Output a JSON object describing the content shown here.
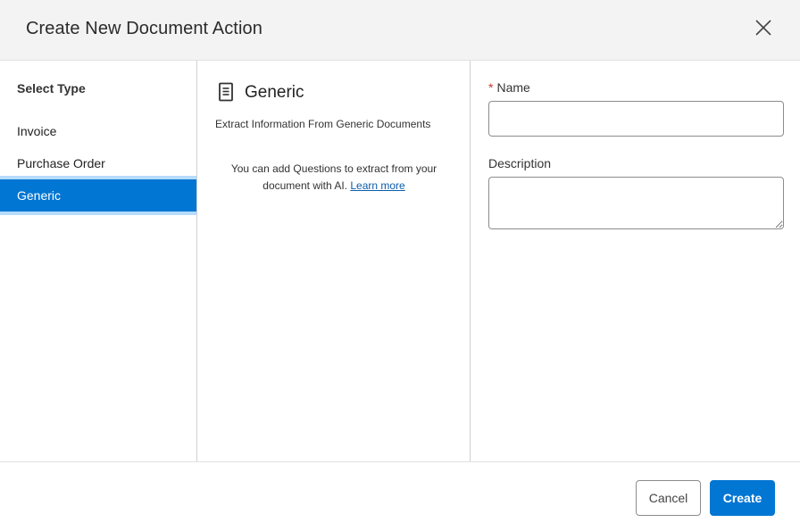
{
  "dialog": {
    "title": "Create New Document Action"
  },
  "types": {
    "heading": "Select Type",
    "items": [
      {
        "label": "Invoice"
      },
      {
        "label": "Purchase Order"
      },
      {
        "label": "Generic",
        "selected": true
      }
    ]
  },
  "details": {
    "icon": "document-icon",
    "title": "Generic",
    "description": "Extract Information From Generic Documents",
    "hint_text": "You can add Questions to extract from your document with AI.",
    "hint_link": "Learn more"
  },
  "form": {
    "required_marker": "*",
    "name_label": "Name",
    "name_value": "",
    "description_label": "Description",
    "description_value": ""
  },
  "footer": {
    "cancel_label": "Cancel",
    "create_label": "Create"
  },
  "colors": {
    "accent": "#0176d3",
    "selected_border": "#b6dcfb",
    "required": "#c23934",
    "link": "#0b5cab"
  }
}
